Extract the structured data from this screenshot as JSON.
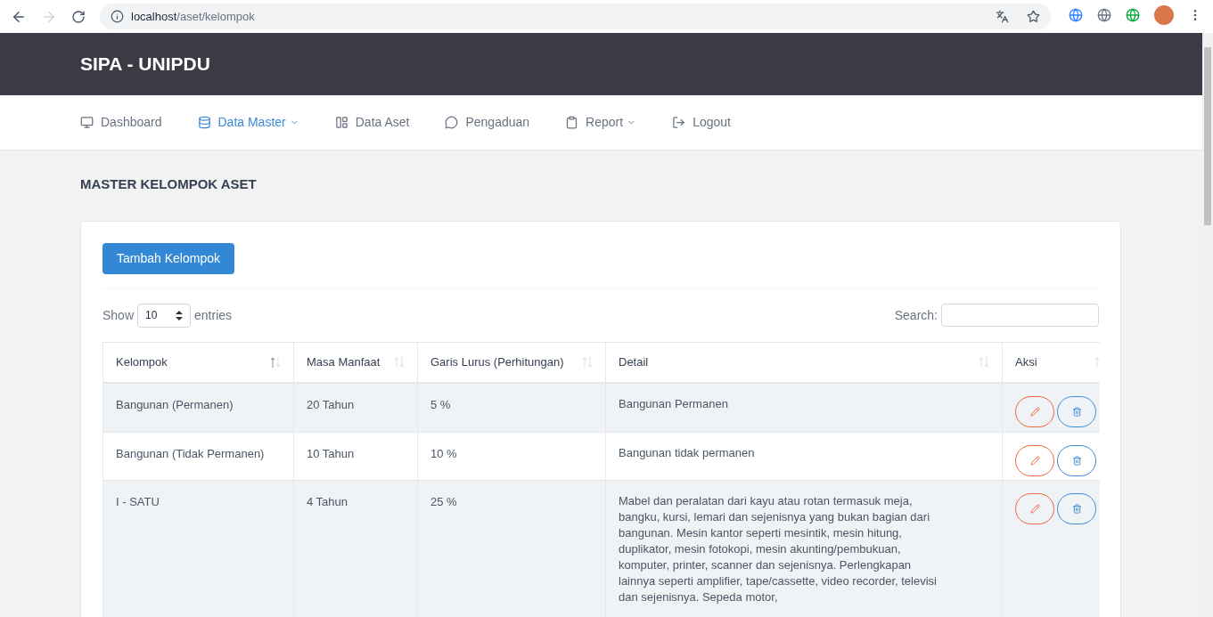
{
  "browser": {
    "url_host": "localhost",
    "url_path": "/aset/kelompok"
  },
  "header": {
    "brand": "SIPA - UNIPDU"
  },
  "nav": [
    {
      "label": "Dashboard",
      "selected": false,
      "dropdown": false
    },
    {
      "label": "Data Master",
      "selected": true,
      "dropdown": true
    },
    {
      "label": "Data Aset",
      "selected": false,
      "dropdown": false
    },
    {
      "label": "Pengaduan",
      "selected": false,
      "dropdown": false
    },
    {
      "label": "Report",
      "selected": false,
      "dropdown": true
    },
    {
      "label": "Logout",
      "selected": false,
      "dropdown": false
    }
  ],
  "page_title": "MASTER KELOMPOK ASET",
  "add_button": "Tambah Kelompok",
  "length": {
    "show": "Show",
    "value": "10",
    "entries": "entries"
  },
  "search": {
    "label": "Search:"
  },
  "table": {
    "columns": [
      {
        "label": "Kelompok",
        "sorted": true
      },
      {
        "label": "Masa Manfaat",
        "sorted": false
      },
      {
        "label": "Garis Lurus (Perhitungan)",
        "sorted": false
      },
      {
        "label": "Detail",
        "sorted": false
      },
      {
        "label": "Aksi",
        "sorted": false
      }
    ],
    "rows": [
      {
        "kelompok": "Bangunan (Permanen)",
        "masa": "20 Tahun",
        "garis": "5 %",
        "detail": "Bangunan Permanen"
      },
      {
        "kelompok": "Bangunan (Tidak Permanen)",
        "masa": "10 Tahun",
        "garis": "10 %",
        "detail": "Bangunan tidak permanen"
      },
      {
        "kelompok": "I - SATU",
        "masa": "4 Tahun",
        "garis": "25 %",
        "detail": "Mabel dan peralatan dari kayu atau rotan termasuk meja, bangku, kursi, lemari dan sejenisnya yang bukan bagian dari bangunan. Mesin kantor seperti mesintik, mesin hitung, duplikator, mesin fotokopi, mesin akunting/pembukuan, komputer, printer, scanner dan sejenisnya. Perlengkapan lainnya seperti amplifier, tape/cassette, video recorder, televisi dan sejenisnya. Sepeda motor,"
      }
    ]
  }
}
